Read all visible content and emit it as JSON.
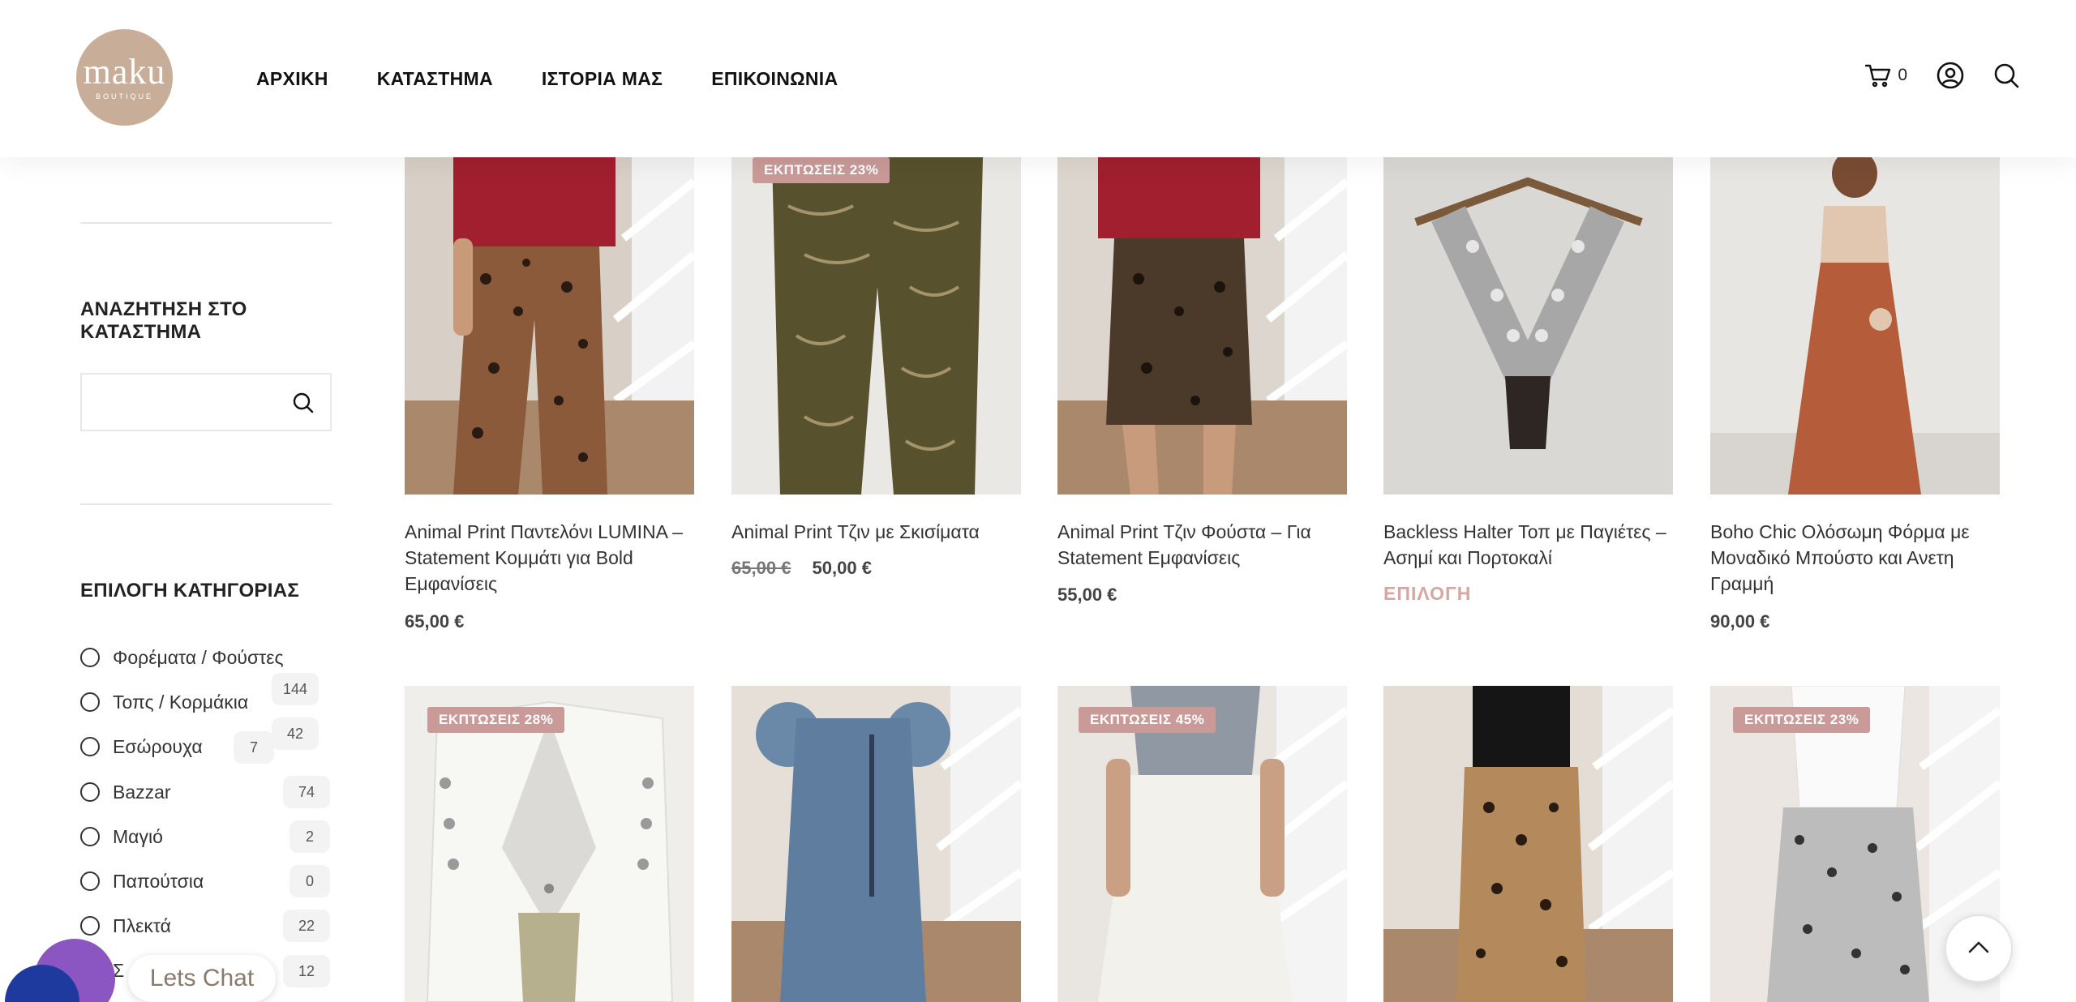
{
  "brand": {
    "name": "maku",
    "tagline": "BOUTIQUE",
    "color": "#c8ad98"
  },
  "nav": [
    "ΑΡΧΙΚΗ",
    "ΚΑΤΑΣΤΗΜΑ",
    "ΙΣΤΟΡΙΑ ΜΑΣ",
    "ΕΠΙΚΟΙΝΩΝΙΑ"
  ],
  "header": {
    "cart_count": "0",
    "icons": [
      "cart-icon",
      "account-icon",
      "search-icon"
    ]
  },
  "sidebar": {
    "search_title": "ΑΝΑΖΗΤΗΣΗ ΣΤΟ ΚΑΤΑΣΤΗΜΑ",
    "search_placeholder": "",
    "category_title": "ΕΠΙΛΟΓΗ ΚΑΤΗΓΟΡΙΑΣ",
    "categories": [
      {
        "label": "Φορέματα / Φούστες",
        "count": "144"
      },
      {
        "label": "Τοπς / Κορμάκια",
        "count": "42"
      },
      {
        "label": "Εσώρουχα",
        "count": "7"
      },
      {
        "label": "Bazzar",
        "count": "74"
      },
      {
        "label": "Μαγιό",
        "count": "2"
      },
      {
        "label": "Παπούτσια",
        "count": "0"
      },
      {
        "label": "Πλεκτά",
        "count": "22"
      },
      {
        "label": "Σ",
        "count": "12"
      }
    ]
  },
  "products": [
    {
      "title": "Animal Print Παντελόνι LUMINA – Statement Κομμάτι για Bold Εμφανίσεις",
      "price": "65,00 €",
      "old_price": "",
      "badge": "",
      "action": ""
    },
    {
      "title": "Animal Print Τζιν με Σκισίματα",
      "price": "50,00 €",
      "old_price": "65,00 €",
      "badge": "ΕΚΠΤΩΣΕΙΣ 23%",
      "action": ""
    },
    {
      "title": "Animal Print Τζιν Φούστα – Για Statement Εμφανίσεις",
      "price": "55,00 €",
      "old_price": "",
      "badge": "",
      "action": ""
    },
    {
      "title": "Backless Halter Τοπ με Παγιέτες – Ασημί και Πορτοκαλί",
      "price": "",
      "old_price": "",
      "badge": "",
      "action": "ΕΠΙΛΟΓΗ"
    },
    {
      "title": "Boho Chic Ολόσωμη Φόρμα με Μοναδικό Μπούστο και Ανετη Γραμμή",
      "price": "90,00 €",
      "old_price": "",
      "badge": "",
      "action": ""
    },
    {
      "title": "",
      "price": "",
      "old_price": "",
      "badge": "ΕΚΠΤΩΣΕΙΣ 28%",
      "action": ""
    },
    {
      "title": "",
      "price": "",
      "old_price": "",
      "badge": "",
      "action": ""
    },
    {
      "title": "",
      "price": "",
      "old_price": "",
      "badge": "ΕΚΠΤΩΣΕΙΣ 45%",
      "action": ""
    },
    {
      "title": "",
      "price": "",
      "old_price": "",
      "badge": "",
      "action": ""
    },
    {
      "title": "",
      "price": "",
      "old_price": "",
      "badge": "ΕΚΠΤΩΣΕΙΣ 23%",
      "action": ""
    }
  ],
  "chat": {
    "label": "Lets Chat"
  },
  "colors": {
    "badge": "#c99a98",
    "select": "#d5a7a2",
    "chat_purple": "#8b56c2",
    "chat_blue": "#1f3a9e"
  }
}
